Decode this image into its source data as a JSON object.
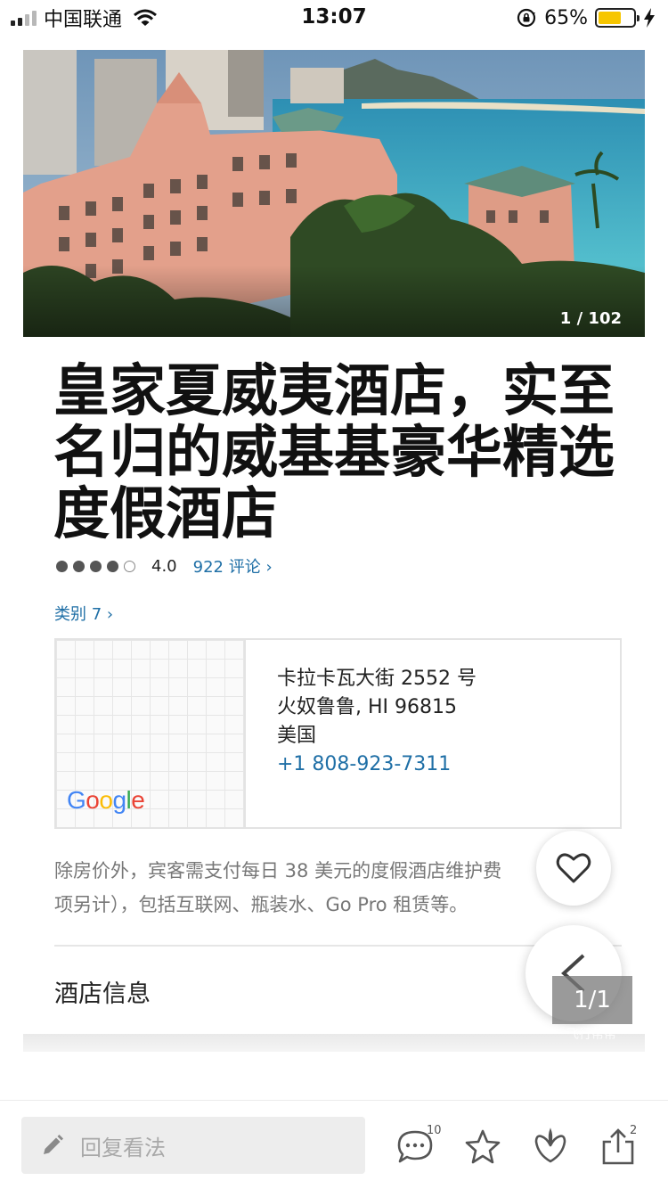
{
  "status_bar": {
    "carrier": "中国联通",
    "time": "13:07",
    "battery_percent": "65%",
    "battery_level": 0.65,
    "battery_color": "#f7c600",
    "icons": [
      "signal-icon",
      "wifi-icon",
      "rotation-lock-icon",
      "battery-icon",
      "charging-bolt-icon"
    ]
  },
  "hero": {
    "photo_counter": "1 / 102"
  },
  "hotel": {
    "title": "皇家夏威夷酒店，实至名归的威基基豪华精选度假酒店",
    "rating": {
      "value": "4.0",
      "filled_dots": 4,
      "total_dots": 5,
      "reviews_link": "922 评论 ›"
    },
    "category_link": "类别 7 ›",
    "address": {
      "line1": "卡拉卡瓦大街 2552 号",
      "line2": "火奴鲁鲁, HI 96815",
      "line3": "美国",
      "phone": "+1 808-923-7311"
    },
    "map_logo": "Google",
    "fee_text": "除房价外，宾客需支付每日 38 美元的度假酒店维护费",
    "fee_text_2": "项另计），包括互联网、瓶装水、Go Pro 租赁等。",
    "section_title": "酒店信息"
  },
  "floating": {
    "page_indicator": "1/1",
    "watermark": "飞行帮帮"
  },
  "bottom_bar": {
    "reply_placeholder": "回复看法",
    "comment_count": "10",
    "share_count": "2",
    "icons": [
      "pencil-icon",
      "comment-icon",
      "star-icon",
      "like-icon",
      "share-icon"
    ]
  },
  "colors": {
    "link": "#1f6fa6",
    "ocean": "#3fa7c4",
    "building": "#e8a08a"
  }
}
